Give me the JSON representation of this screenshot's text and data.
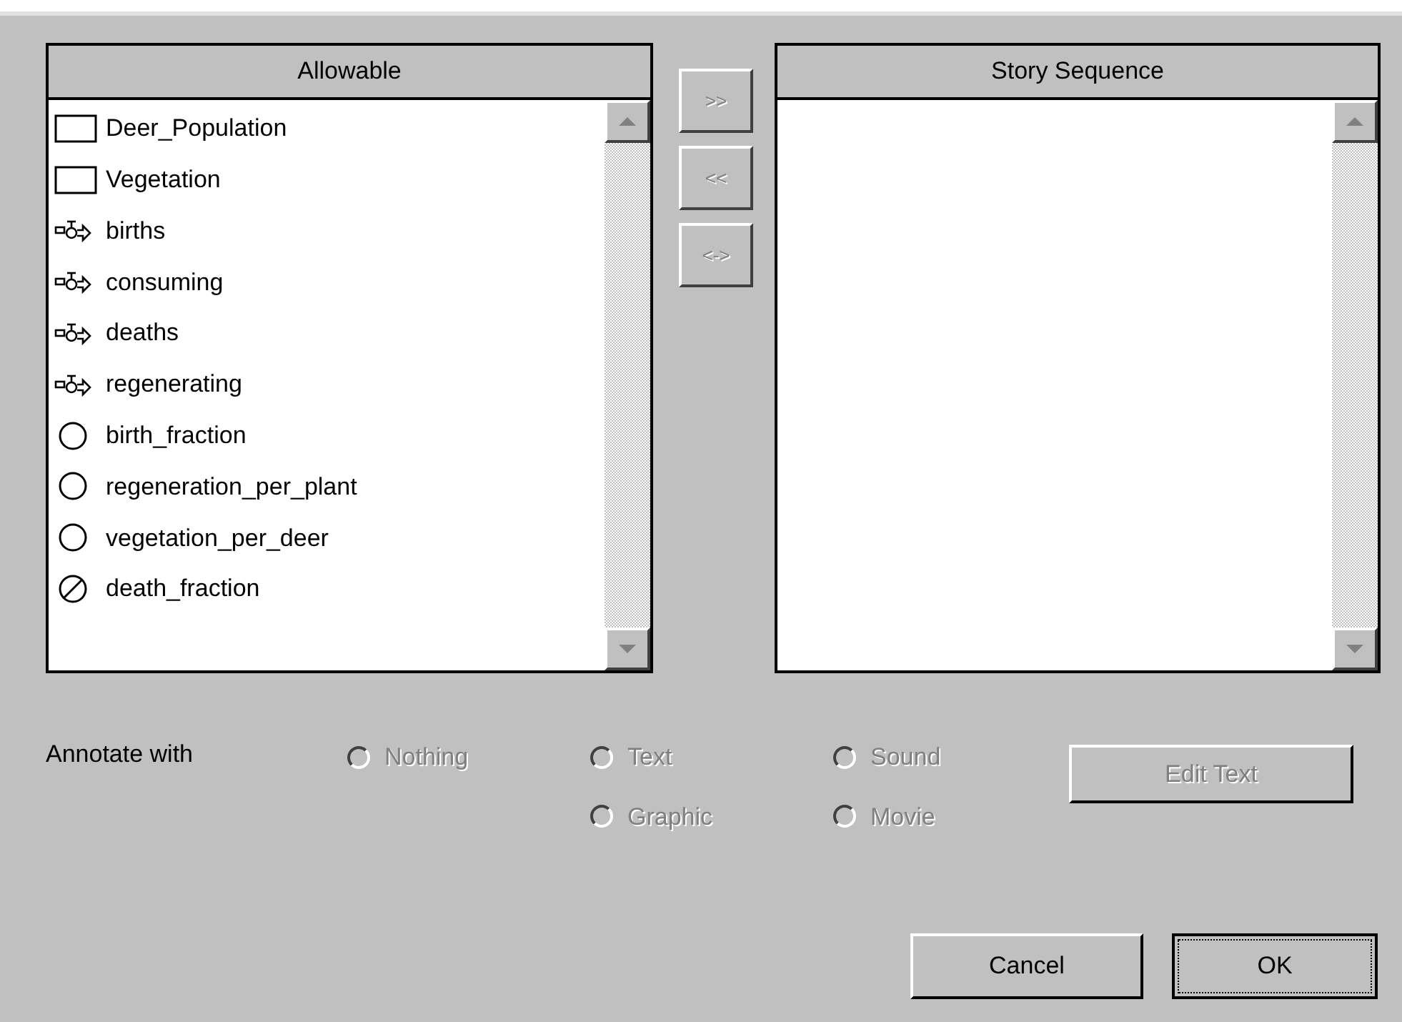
{
  "allowable": {
    "title": "Allowable",
    "items": [
      {
        "kind": "stock",
        "label": "Deer_Population"
      },
      {
        "kind": "stock",
        "label": "Vegetation"
      },
      {
        "kind": "flow",
        "label": "births"
      },
      {
        "kind": "flow",
        "label": "consuming"
      },
      {
        "kind": "flow",
        "label": "deaths"
      },
      {
        "kind": "flow",
        "label": "regenerating"
      },
      {
        "kind": "aux",
        "label": "birth_fraction"
      },
      {
        "kind": "aux",
        "label": "regeneration_per_plant"
      },
      {
        "kind": "aux",
        "label": "vegetation_per_deer"
      },
      {
        "kind": "ghost",
        "label": "death_fraction"
      }
    ]
  },
  "move_buttons": [
    {
      "label": ">>",
      "disabled": true
    },
    {
      "label": "<<",
      "disabled": true
    },
    {
      "label": "<->",
      "disabled": true
    }
  ],
  "story_sequence": {
    "title": "Story Sequence"
  },
  "annotate": {
    "label": "Annotate with",
    "options": [
      {
        "label": "Nothing",
        "selected": false,
        "disabled": true
      },
      {
        "label": "Text",
        "selected": false,
        "disabled": true
      },
      {
        "label": "Graphic",
        "selected": false,
        "disabled": true
      },
      {
        "label": "Sound",
        "selected": false,
        "disabled": true
      },
      {
        "label": "Movie",
        "selected": false,
        "disabled": true
      }
    ],
    "edit_button": {
      "label": "Edit Text",
      "disabled": true
    }
  },
  "buttons": [
    {
      "label": "Cancel",
      "default": false
    },
    {
      "label": "OK",
      "default": true
    }
  ]
}
